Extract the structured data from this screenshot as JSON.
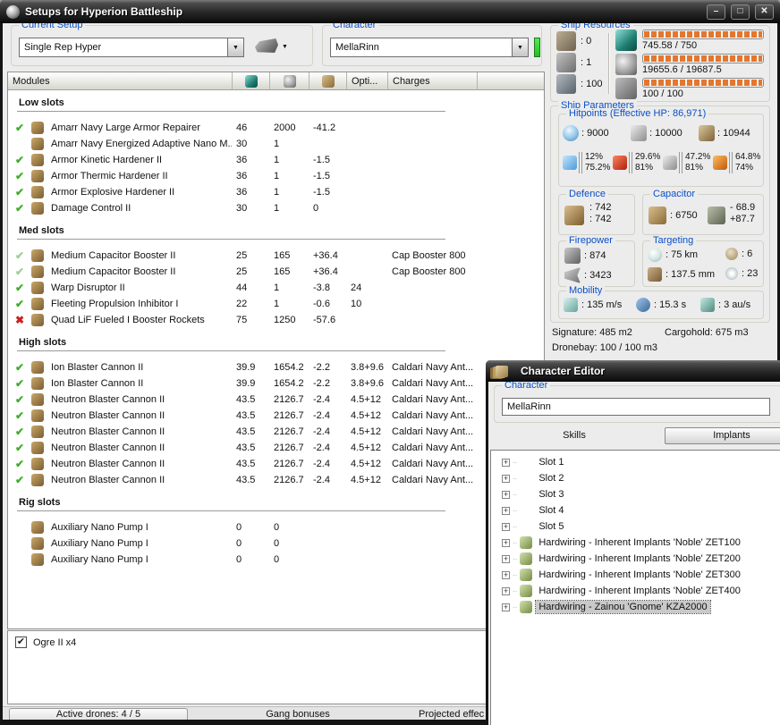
{
  "window": {
    "title": "Setups for Hyperion Battleship",
    "buttons": {
      "minimize": "–",
      "maximize": "□",
      "close": "✕"
    }
  },
  "setup": {
    "label": "Current Setup",
    "value": "Single Rep Hyper"
  },
  "character_box": {
    "label": "Character",
    "value": "MellaRinn"
  },
  "resources": {
    "label": "Ship Resources",
    "hardpoints": [
      {
        "icon": "turret-hardpoint-icon",
        "value": ": 0"
      },
      {
        "icon": "launcher-hardpoint-icon",
        "value": ": 1"
      },
      {
        "icon": "calibration-icon",
        "value": ": 100"
      }
    ],
    "bars": [
      {
        "icon": "cpu-icon",
        "text": "745.58 / 750"
      },
      {
        "icon": "powergrid-icon",
        "text": "19655.6 / 19687.5"
      },
      {
        "icon": "dronebay-icon",
        "text": "100 / 100"
      }
    ]
  },
  "modules": {
    "header": {
      "modules": "Modules",
      "opti": "Opti...",
      "charges": "Charges"
    },
    "sections": [
      {
        "title": "Low slots",
        "rows": [
          {
            "state": "on",
            "check": "✔",
            "icon": "armor-repairer-icon",
            "name": "Amarr Navy Large Armor Repairer",
            "cpu": "46",
            "pg": "2000",
            "cap": "-41.2",
            "opt": "",
            "charge": ""
          },
          {
            "state": "none",
            "check": "",
            "icon": "energized-membrane-icon",
            "name": "Amarr Navy Energized Adaptive Nano M...",
            "cpu": "30",
            "pg": "1",
            "cap": "",
            "opt": "",
            "charge": ""
          },
          {
            "state": "on",
            "check": "✔",
            "icon": "armor-hardener-icon",
            "name": "Armor Kinetic Hardener II",
            "cpu": "36",
            "pg": "1",
            "cap": "-1.5",
            "opt": "",
            "charge": ""
          },
          {
            "state": "on",
            "check": "✔",
            "icon": "armor-hardener-icon",
            "name": "Armor Thermic Hardener II",
            "cpu": "36",
            "pg": "1",
            "cap": "-1.5",
            "opt": "",
            "charge": ""
          },
          {
            "state": "on",
            "check": "✔",
            "icon": "armor-hardener-icon",
            "name": "Armor Explosive Hardener II",
            "cpu": "36",
            "pg": "1",
            "cap": "-1.5",
            "opt": "",
            "charge": ""
          },
          {
            "state": "on",
            "check": "✔",
            "icon": "damage-control-icon",
            "name": "Damage Control II",
            "cpu": "30",
            "pg": "1",
            "cap": "0",
            "opt": "",
            "charge": ""
          }
        ]
      },
      {
        "title": "Med slots",
        "rows": [
          {
            "state": "dim",
            "check": "✔",
            "icon": "cap-booster-icon",
            "name": "Medium Capacitor Booster II",
            "cpu": "25",
            "pg": "165",
            "cap": "+36.4",
            "opt": "",
            "charge": "Cap Booster 800"
          },
          {
            "state": "dim",
            "check": "✔",
            "icon": "cap-booster-icon",
            "name": "Medium Capacitor Booster II",
            "cpu": "25",
            "pg": "165",
            "cap": "+36.4",
            "opt": "",
            "charge": "Cap Booster 800"
          },
          {
            "state": "on",
            "check": "✔",
            "icon": "warp-disruptor-icon",
            "name": "Warp Disruptor II",
            "cpu": "44",
            "pg": "1",
            "cap": "-3.8",
            "opt": "24",
            "charge": ""
          },
          {
            "state": "on",
            "check": "✔",
            "icon": "stasis-webifier-icon",
            "name": "Fleeting Propulsion Inhibitor I",
            "cpu": "22",
            "pg": "1",
            "cap": "-0.6",
            "opt": "10",
            "charge": ""
          },
          {
            "state": "bad",
            "check": "✖",
            "icon": "booster-rockets-icon",
            "name": "Quad LiF Fueled I Booster Rockets",
            "cpu": "75",
            "pg": "1250",
            "cap": "-57.6",
            "opt": "",
            "charge": ""
          }
        ]
      },
      {
        "title": "High slots",
        "rows": [
          {
            "state": "on",
            "check": "✔",
            "icon": "blaster-icon",
            "name": "Ion Blaster Cannon II",
            "cpu": "39.9",
            "pg": "1654.2",
            "cap": "-2.2",
            "opt": "3.8+9.6",
            "charge": "Caldari Navy Ant..."
          },
          {
            "state": "on",
            "check": "✔",
            "icon": "blaster-icon",
            "name": "Ion Blaster Cannon II",
            "cpu": "39.9",
            "pg": "1654.2",
            "cap": "-2.2",
            "opt": "3.8+9.6",
            "charge": "Caldari Navy Ant..."
          },
          {
            "state": "on",
            "check": "✔",
            "icon": "blaster-icon",
            "name": "Neutron Blaster Cannon II",
            "cpu": "43.5",
            "pg": "2126.7",
            "cap": "-2.4",
            "opt": "4.5+12",
            "charge": "Caldari Navy Ant..."
          },
          {
            "state": "on",
            "check": "✔",
            "icon": "blaster-icon",
            "name": "Neutron Blaster Cannon II",
            "cpu": "43.5",
            "pg": "2126.7",
            "cap": "-2.4",
            "opt": "4.5+12",
            "charge": "Caldari Navy Ant..."
          },
          {
            "state": "on",
            "check": "✔",
            "icon": "blaster-icon",
            "name": "Neutron Blaster Cannon II",
            "cpu": "43.5",
            "pg": "2126.7",
            "cap": "-2.4",
            "opt": "4.5+12",
            "charge": "Caldari Navy Ant..."
          },
          {
            "state": "on",
            "check": "✔",
            "icon": "blaster-icon",
            "name": "Neutron Blaster Cannon II",
            "cpu": "43.5",
            "pg": "2126.7",
            "cap": "-2.4",
            "opt": "4.5+12",
            "charge": "Caldari Navy Ant..."
          },
          {
            "state": "on",
            "check": "✔",
            "icon": "blaster-icon",
            "name": "Neutron Blaster Cannon II",
            "cpu": "43.5",
            "pg": "2126.7",
            "cap": "-2.4",
            "opt": "4.5+12",
            "charge": "Caldari Navy Ant..."
          },
          {
            "state": "on",
            "check": "✔",
            "icon": "blaster-icon",
            "name": "Neutron Blaster Cannon II",
            "cpu": "43.5",
            "pg": "2126.7",
            "cap": "-2.4",
            "opt": "4.5+12",
            "charge": "Caldari Navy Ant..."
          }
        ]
      },
      {
        "title": "Rig slots",
        "rows": [
          {
            "state": "none",
            "check": "",
            "icon": "rig-icon",
            "name": "Auxiliary Nano Pump I",
            "cpu": "0",
            "pg": "0",
            "cap": "",
            "opt": "",
            "charge": ""
          },
          {
            "state": "none",
            "check": "",
            "icon": "rig-icon",
            "name": "Auxiliary Nano Pump I",
            "cpu": "0",
            "pg": "0",
            "cap": "",
            "opt": "",
            "charge": ""
          },
          {
            "state": "none",
            "check": "",
            "icon": "rig-icon",
            "name": "Auxiliary Nano Pump I",
            "cpu": "0",
            "pg": "0",
            "cap": "",
            "opt": "",
            "charge": ""
          }
        ]
      }
    ]
  },
  "parameters": {
    "label": "Ship Parameters",
    "hitpoints": {
      "label": "Hitpoints (Effective HP: 86,971)",
      "hp": [
        {
          "icon": "shield-icon",
          "value": ": 9000"
        },
        {
          "icon": "armor-icon",
          "value": ": 10000"
        },
        {
          "icon": "structure-icon",
          "value": ": 10944"
        }
      ],
      "resists": [
        {
          "icon": "em-resist-icon",
          "shield": "12%",
          "armor": "75.2%"
        },
        {
          "icon": "thermal-resist-icon",
          "shield": "29.6%",
          "armor": "81%"
        },
        {
          "icon": "kinetic-resist-icon",
          "shield": "47.2%",
          "armor": "81%"
        },
        {
          "icon": "explosive-resist-icon",
          "shield": "64.8%",
          "armor": "74%"
        }
      ]
    },
    "defence": {
      "label": "Defence",
      "value_top": ": 742",
      "value_bottom": ": 742"
    },
    "capacitor": {
      "label": "Capacitor",
      "amount": ": 6750",
      "delta_top": "- 68.9",
      "delta_bottom": "+87.7"
    },
    "firepower": {
      "label": "Firepower",
      "dps": ": 874",
      "volley": ": 3423"
    },
    "targeting": {
      "label": "Targeting",
      "range": ": 75 km",
      "max_targets": ": 6",
      "scan_res": ": 137.5 mm",
      "sensor": ": 23"
    },
    "mobility": {
      "label": "Mobility",
      "speed": ": 135 m/s",
      "align": ": 15.3 s",
      "warp": ": 3 au/s"
    },
    "signature": "Signature: 485 m2",
    "cargohold": "Cargohold: 675 m3",
    "dronebay": "Dronebay: 100 / 100 m3"
  },
  "drones": {
    "items": [
      {
        "check": "✔",
        "label": "Ogre II x4"
      }
    ]
  },
  "status": {
    "active_drones": "Active drones: 4 / 5",
    "gang": "Gang bonuses",
    "projected": "Projected effec"
  },
  "editor": {
    "title": "Character Editor",
    "character": {
      "label": "Character",
      "value": "MellaRinn"
    },
    "tabs": {
      "skills": "Skills",
      "implants": "Implants"
    },
    "tree": [
      {
        "label": "Slot 1",
        "icon": "",
        "selected": false
      },
      {
        "label": "Slot 2",
        "icon": "",
        "selected": false
      },
      {
        "label": "Slot 3",
        "icon": "",
        "selected": false
      },
      {
        "label": "Slot 4",
        "icon": "",
        "selected": false
      },
      {
        "label": "Slot 5",
        "icon": "",
        "selected": false
      },
      {
        "label": "Hardwiring - Inherent Implants 'Noble' ZET100",
        "icon": "implant-icon",
        "selected": false
      },
      {
        "label": "Hardwiring - Inherent Implants 'Noble' ZET200",
        "icon": "implant-icon",
        "selected": false
      },
      {
        "label": "Hardwiring - Inherent Implants 'Noble' ZET300",
        "icon": "implant-icon",
        "selected": false
      },
      {
        "label": "Hardwiring - Inherent Implants 'Noble' ZET400",
        "icon": "implant-icon",
        "selected": false
      },
      {
        "label": "Hardwiring - Zainou 'Gnome' KZA2000",
        "icon": "implant-icon",
        "selected": true
      }
    ]
  }
}
